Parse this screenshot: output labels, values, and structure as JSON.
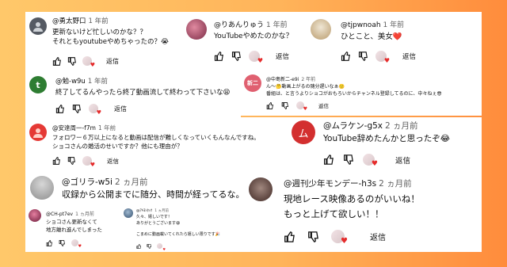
{
  "colors": {
    "background_left": "#ffc86a",
    "background_right": "#ff8c3c",
    "card": "#ffffff",
    "heart": "#e52b2b",
    "muted": "#606060"
  },
  "comments": [
    {
      "handle": "@勇太野口",
      "time": "1 年前",
      "lines": [
        "更新ないけど忙しいのかな？？",
        "それともyoutubeやめちゃったの？😭"
      ],
      "reply": "返信",
      "avatar_color": "#555a63",
      "avatar_icon": "person-icon"
    },
    {
      "handle": "@りあんりゅう",
      "time": "1 年前",
      "lines": [
        "YouTubeやめたのかな？"
      ],
      "reply": "返信",
      "avatar_color": "#b0466a",
      "avatar_icon": "photo-avatar"
    },
    {
      "handle": "@tjpwnoah",
      "time": "1 年前",
      "lines": [
        "ひとこと、美女❤️"
      ],
      "reply": "返信",
      "avatar_color": "#c9b99a",
      "avatar_icon": "photo-avatar"
    },
    {
      "handle": "@勉-w9u",
      "time": "1 年前",
      "lines": [
        "終了してるんやったら終了動画流して終わって下さいな😫"
      ],
      "reply": "返信",
      "avatar_color": "#2e7d32",
      "avatar_letter": "t"
    },
    {
      "handle": "@中島新二-e9i",
      "time": "2 年前",
      "lines": [
        "ん〜🤔動画上がるの随分遅いなぁ🙁",
        "番組は、と言うよりショコがおもろいからチャンネル登録してるのに、中々ねぇ😎"
      ],
      "reply": "返信",
      "avatar_color": "#e06070",
      "avatar_letter": "新二"
    },
    {
      "handle": "@安達周一-f7m",
      "time": "1 年前",
      "lines": [
        "フォロワー６万以上になると動画は配信が難しくなっていくもんなんですね。",
        "ショコさんの婚活のせいですか？他にも理由が？"
      ],
      "reply": "返信",
      "avatar_color": "#e53935",
      "avatar_icon": "person-icon"
    },
    {
      "handle": "@ムラケン-g5x",
      "time": "2 ヵ月前",
      "lines": [
        "YouTube辞めたんかと思ったぞ😂"
      ],
      "reply": "返信",
      "avatar_color": "#d32f2f",
      "avatar_letter": "ム"
    },
    {
      "handle": "@ゴリラ-w5i",
      "time": "2 ヵ月前",
      "lines": [
        "収録から公開までに随分、時間が経ってるな。"
      ],
      "avatar_color": "#9e9e9e",
      "avatar_icon": "photo-avatar"
    },
    {
      "handle": "@週刊少年モンデー-h3s",
      "time": "2 ヵ月前",
      "lines": [
        "現地レース映像あるのがいいね！",
        "もっと上げて欲しい！！"
      ],
      "reply": "返信",
      "avatar_color": "#6d4c41",
      "avatar_icon": "photo-avatar"
    },
    {
      "handle": "@CH-pt7ev",
      "time": "1 ヵ月前",
      "lines": [
        "ショコさん更新なくて",
        "地方離れ進んでしまった"
      ],
      "avatar_color": "#b03060",
      "avatar_icon": "photo-avatar"
    },
    {
      "handle": "@ｱｷﾖｼﾀｯｸ",
      "time": "1 ヵ月前",
      "lines": [
        "久々、嬉しいです！",
        "ありがとうございます😆",
        "",
        "こまめに動画載いてくれたら嬉しい限りです🎉"
      ],
      "avatar_color": "#5c7fa3",
      "avatar_icon": "photo-avatar"
    }
  ]
}
